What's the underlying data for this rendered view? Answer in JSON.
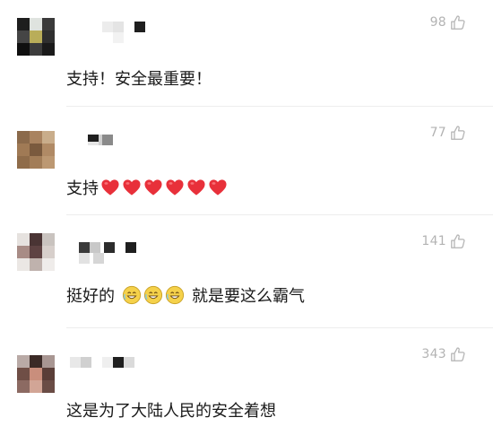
{
  "comments": [
    {
      "likes": "98",
      "text": "支持！安全最重要！"
    },
    {
      "likes": "77",
      "text": "支持",
      "hearts": [
        "red-heart",
        "red-heart",
        "red-heart",
        "red-heart",
        "red-heart",
        "red-heart"
      ]
    },
    {
      "likes": "141",
      "text_before": "挺好的",
      "emojis": [
        "grin-face",
        "grin-face",
        "grin-face"
      ],
      "text_after": "就是要这么霸气"
    },
    {
      "likes": "343",
      "text": "这是为了大陆人民的安全着想"
    }
  ],
  "colors": {
    "like_gray": "#b3b3b3",
    "text": "#1a1a1a",
    "heart_red": "#e8303a",
    "emoji_yellow": "#f5d14a"
  }
}
